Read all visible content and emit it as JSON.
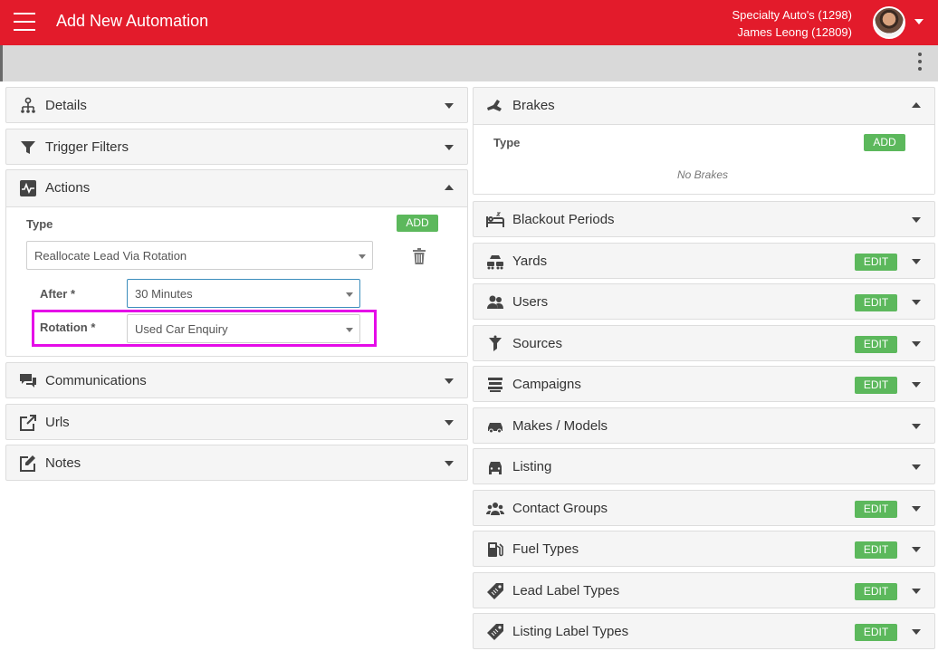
{
  "header": {
    "title": "Add New Automation",
    "dealer": "Specialty Auto's (1298)",
    "user": "James Leong (12809)"
  },
  "colors": {
    "header": "#e31b2b",
    "accent_green": "#5cb85c",
    "highlight": "#e50ce8"
  },
  "left_panels": {
    "details": "Details",
    "trigger_filters": "Trigger Filters",
    "actions": "Actions",
    "communications": "Communications",
    "urls": "Urls",
    "notes": "Notes"
  },
  "actions": {
    "type_label": "Type",
    "add_label": "ADD",
    "type_value": "Reallocate Lead Via Rotation",
    "after_label": "After *",
    "after_value": "30 Minutes",
    "rotation_label": "Rotation *",
    "rotation_value": "Used Car Enquiry"
  },
  "brakes": {
    "title": "Brakes",
    "type_label": "Type",
    "add_label": "ADD",
    "empty": "No Brakes"
  },
  "right_panels": [
    {
      "title": "Blackout Periods",
      "edit": ""
    },
    {
      "title": "Yards",
      "edit": "EDIT"
    },
    {
      "title": "Users",
      "edit": "EDIT"
    },
    {
      "title": "Sources",
      "edit": "EDIT"
    },
    {
      "title": "Campaigns",
      "edit": "EDIT"
    },
    {
      "title": "Makes / Models",
      "edit": ""
    },
    {
      "title": "Listing",
      "edit": ""
    },
    {
      "title": "Contact Groups",
      "edit": "EDIT"
    },
    {
      "title": "Fuel Types",
      "edit": "EDIT"
    },
    {
      "title": "Lead Label Types",
      "edit": "EDIT"
    },
    {
      "title": "Listing Label Types",
      "edit": "EDIT"
    }
  ]
}
